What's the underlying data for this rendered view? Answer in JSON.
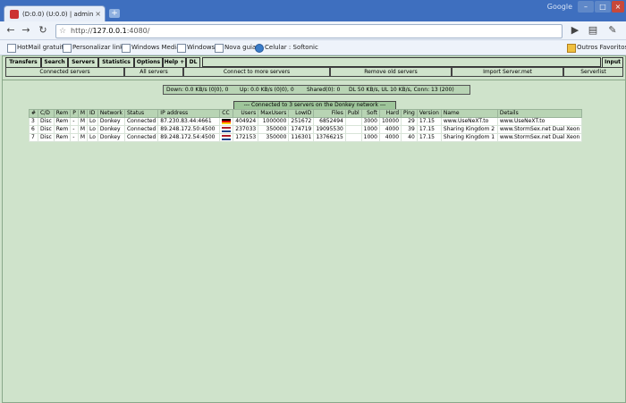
{
  "browser": {
    "tab_title": "(D:0.0) (U:0.0) | admin | M...",
    "tab_close": "×",
    "new_tab": "+",
    "brand": "Google",
    "url_host": "127.0.0.1",
    "url_prefix": "http://",
    "url_port": ":4080/"
  },
  "bookmarks": [
    {
      "label": "HotMail gratuito"
    },
    {
      "label": "Personalizar links"
    },
    {
      "label": "Windows Media"
    },
    {
      "label": "Windows"
    },
    {
      "label": "Nova guia"
    },
    {
      "label": "Celular : Softonic"
    },
    {
      "label": "Outros Favoritos"
    }
  ],
  "menu": {
    "items": [
      "Transfers",
      "Search",
      "Servers",
      "Statistics",
      "Options",
      "Help +",
      "DL"
    ],
    "input_label": "Input"
  },
  "submenu": {
    "items": [
      "Connected servers",
      "All servers",
      "Connect to more servers",
      "Remove old servers",
      "Import Server.met",
      "Serverlist"
    ]
  },
  "status": {
    "down": "Down: 0.0 KB/s (0|0), 0",
    "up": "Up: 0.0 KB/s (0|0), 0",
    "shared": "Shared(0): 0",
    "limits": "DL 50 KB/s, UL 10 KB/s, Conn: 13 (200)"
  },
  "banner": "--- Connected to 3 servers on the Donkey network ---",
  "table": {
    "headers": [
      "#",
      "C/D",
      "Rem",
      "P",
      "M",
      "ID",
      "Network",
      "Status",
      "IP address",
      "CC",
      "Users",
      "MaxUsers",
      "LowID",
      "Files",
      "Publ",
      "Soft",
      "Hard",
      "Ping",
      "Version",
      "Name",
      "Details"
    ],
    "rows": [
      [
        "3",
        "Disc",
        "Rem",
        "-",
        "M",
        "Lo",
        "Donkey",
        "Connected",
        "87.230.83.44:4661",
        "",
        "404924",
        "1000000",
        "251672",
        "6852494",
        "",
        "3000",
        "10000",
        "29",
        "17.15",
        "www.UseNeXT.to",
        "www.UseNeXT.to"
      ],
      [
        "6",
        "Disc",
        "Rem",
        "-",
        "M",
        "Lo",
        "Donkey",
        "Connected",
        "89.248.172.50:4500",
        "",
        "237033",
        "350000",
        "174719",
        "19095530",
        "",
        "1000",
        "4000",
        "39",
        "17.15",
        "Sharing Kingdom 2",
        "www.StormSex.net Dual Xeon"
      ],
      [
        "7",
        "Disc",
        "Rem",
        "-",
        "M",
        "Lo",
        "Donkey",
        "Connected",
        "89.248.172.54:4500",
        "",
        "172153",
        "350000",
        "116301",
        "13766215",
        "",
        "1000",
        "4000",
        "40",
        "17.15",
        "Sharing Kingdom 1",
        "www.StormSex.net Dual Xeon"
      ]
    ],
    "row_flags": [
      "de",
      "nl",
      "nl"
    ]
  },
  "colors": {
    "app_bg": "#cfe3cb",
    "header_bg": "#b8d4b4",
    "chrome_blue": "#3e6fbf"
  }
}
